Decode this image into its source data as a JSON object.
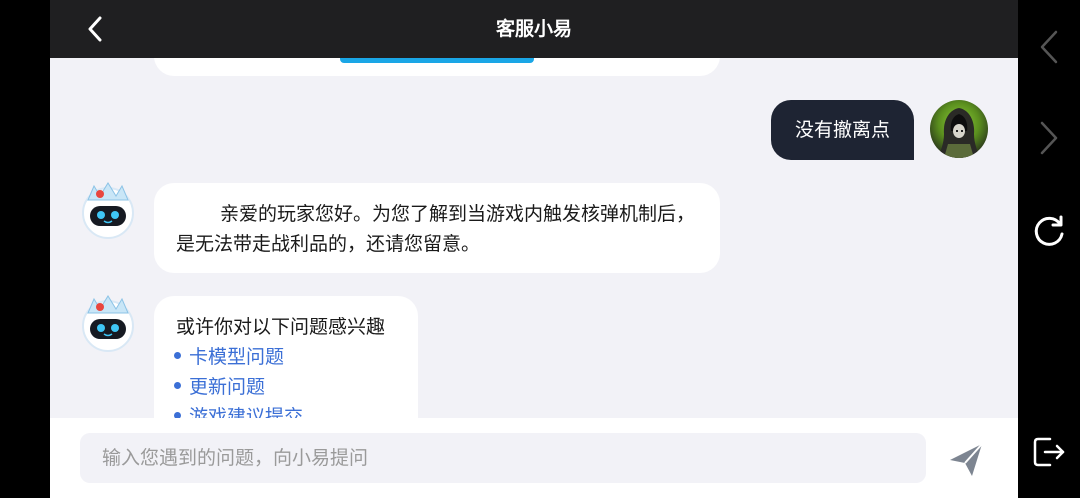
{
  "header": {
    "title": "客服小易"
  },
  "chat": {
    "user_message": "没有撤离点",
    "bot_reply": "亲爱的玩家您好。为您了解到当游戏内触发核弹机制后，是无法带走战利品的，还请您留意。",
    "suggestions_lead": "或许你对以下问题感兴趣",
    "suggestions": [
      "卡模型问题",
      "更新问题",
      "游戏建议提交"
    ]
  },
  "input": {
    "placeholder": "输入您遇到的问题，向小易提问"
  },
  "colors": {
    "header_bg": "#1f1f21",
    "chat_bg": "#f2f2f7",
    "user_bubble": "#1e2433",
    "link": "#3b6fd6",
    "accent_button": "#1aa6e6"
  },
  "icons": {
    "back": "chevron-left-icon",
    "send": "paper-plane-icon",
    "nav_back": "chevron-left-icon",
    "nav_forward": "chevron-right-icon",
    "refresh": "refresh-icon",
    "exit": "exit-icon"
  }
}
